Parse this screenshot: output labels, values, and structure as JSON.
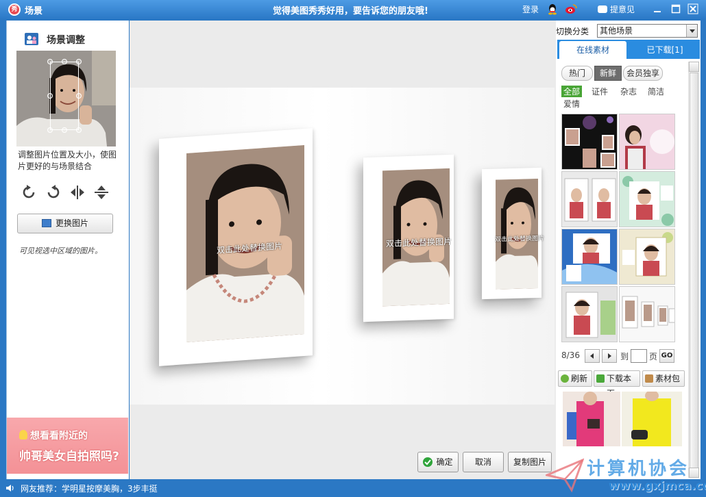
{
  "titlebar": {
    "app_icon_text": "秀",
    "title": "场景",
    "slogan": "觉得美图秀秀好用，要告诉您的朋友哦!",
    "login": "登录",
    "feedback": "提意见"
  },
  "left": {
    "section_title": "场景调整",
    "hint": "调整图片位置及大小，使图片更好的与场景结合",
    "replace_button": "更换图片",
    "hand_note": "可见视选中区域的图片。",
    "ad_line1": "想看看附近的",
    "ad_line2": "帅哥美女自拍照吗?"
  },
  "stage": {
    "caption": "双击此处替换图片",
    "ok_button": "确定",
    "cancel_button": "取消",
    "copy_button": "复制图片"
  },
  "right": {
    "switch_label": "切换分类",
    "switch_value": "其他场景",
    "tab_online": "在线素材",
    "tab_downloaded": "已下载[1]",
    "chips": [
      "热门",
      "新鲜",
      "会员独享"
    ],
    "filters": [
      "全部",
      "证件",
      "杂志",
      "简洁",
      "爱情"
    ],
    "page_indicator": "8/36",
    "page_to": "到",
    "page_unit": "页",
    "go": "GO",
    "refresh": "刷新",
    "download_page": "下载本页",
    "material_pack": "素材包"
  },
  "status": {
    "news": "网友推荐：学明星按摩美胸，3步丰挺"
  },
  "watermark": {
    "title": "计算机协会",
    "url": "www.gxjmca.com"
  },
  "colors": {
    "titlebar": "#2a78c6",
    "accent_tab": "#2a8ce0",
    "green": "#49a536",
    "ad_pink": "#f39196"
  },
  "icons": [
    "app-logo-icon",
    "qq-icon",
    "weibo-icon",
    "feedback-icon",
    "minimize-icon",
    "maximize-icon",
    "close-icon",
    "scene-icon",
    "rotate-left-icon",
    "rotate-right-icon",
    "flip-horizontal-icon",
    "flip-vertical-icon",
    "picture-icon",
    "ok-check-icon",
    "refresh-icon",
    "download-icon",
    "package-icon",
    "speaker-icon"
  ]
}
